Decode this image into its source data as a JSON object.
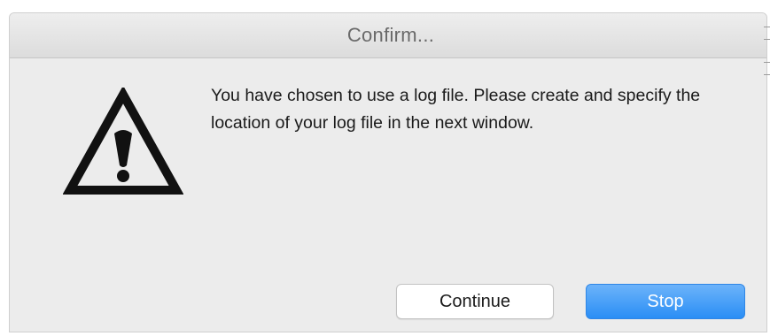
{
  "dialog": {
    "title": "Confirm...",
    "icon": "warning-triangle-icon",
    "message": "You have chosen to use a log file. Please create and specify the location of your log file in the next window.",
    "buttons": {
      "continue_label": "Continue",
      "stop_label": "Stop"
    }
  },
  "colors": {
    "default_button": "#2a8ef5",
    "dialog_background": "#ececec",
    "title_text": "#6a6a6a"
  }
}
